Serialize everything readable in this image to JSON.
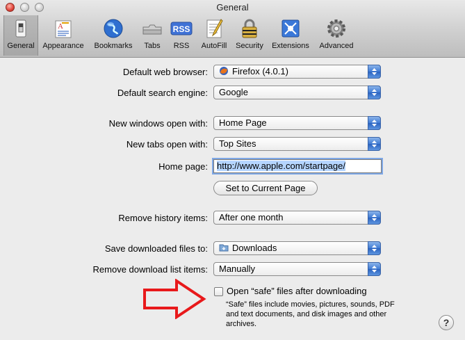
{
  "window": {
    "title": "General"
  },
  "toolbar": {
    "tabs": [
      {
        "label": "General",
        "icon": "general-switch-icon",
        "selected": true
      },
      {
        "label": "Appearance",
        "icon": "appearance-icon"
      },
      {
        "label": "Bookmarks",
        "icon": "bookmarks-globe-icon"
      },
      {
        "label": "Tabs",
        "icon": "tabs-icon"
      },
      {
        "label": "RSS",
        "icon": "rss-icon",
        "badge": "RSS"
      },
      {
        "label": "AutoFill",
        "icon": "autofill-icon"
      },
      {
        "label": "Security",
        "icon": "security-lock-icon"
      },
      {
        "label": "Extensions",
        "icon": "extensions-icon"
      },
      {
        "label": "Advanced",
        "icon": "advanced-gear-icon"
      }
    ]
  },
  "prefs": {
    "default_browser": {
      "label": "Default web browser:",
      "value": "Firefox (4.0.1)"
    },
    "search_engine": {
      "label": "Default search engine:",
      "value": "Google"
    },
    "new_windows": {
      "label": "New windows open with:",
      "value": "Home Page"
    },
    "new_tabs": {
      "label": "New tabs open with:",
      "value": "Top Sites"
    },
    "home_page": {
      "label": "Home page:",
      "value": "http://www.apple.com/startpage/"
    },
    "set_current_page": {
      "label": "Set to Current Page"
    },
    "remove_history": {
      "label": "Remove history items:",
      "value": "After one month"
    },
    "save_downloads": {
      "label": "Save downloaded files to:",
      "value": "Downloads"
    },
    "remove_downloads": {
      "label": "Remove download list items:",
      "value": "Manually"
    },
    "open_safe": {
      "label": "Open “safe” files after downloading",
      "checked": false,
      "description": "“Safe” files include movies, pictures, sounds, PDF and text documents, and disk images and other archives."
    },
    "help": {
      "label": "?"
    }
  },
  "colors": {
    "annotation_arrow": "#e8191b",
    "accent": "#3f7bd4"
  }
}
